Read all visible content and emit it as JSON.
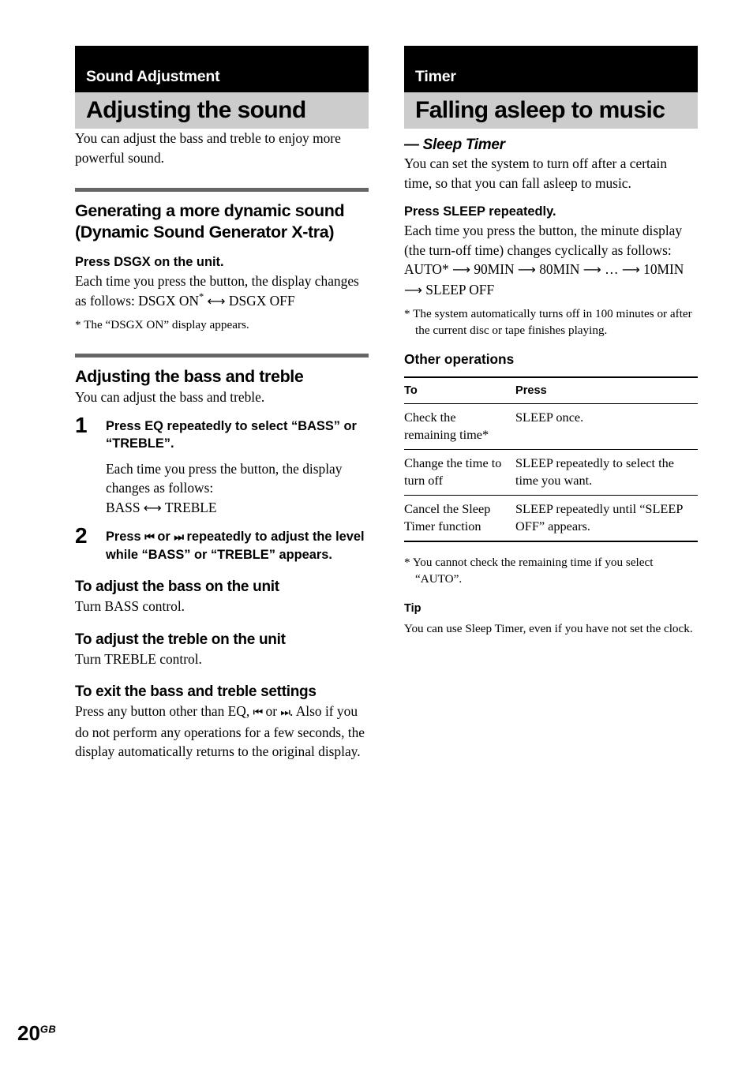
{
  "page": {
    "number": "20",
    "region_code": "GB"
  },
  "left_column": {
    "chapter": "Sound Adjustment",
    "title": "Adjusting the sound",
    "intro": "You can adjust the bass and treble to enjoy more powerful sound.",
    "section_dsgx": {
      "heading": "Generating a more dynamic sound (Dynamic Sound Generator X-tra)",
      "instruction": "Press DSGX on the unit.",
      "body_prefix": "Each time you press the button, the display changes as follows: DSGX ON",
      "star": "*",
      "arrow": "⟷",
      "body_suffix": "DSGX OFF",
      "footnote": "* The “DSGX ON” display appears."
    },
    "section_bass_treble": {
      "heading": "Adjusting the bass and treble",
      "intro": "You can adjust the bass and treble.",
      "steps": [
        {
          "number": "1",
          "title": "Press EQ repeatedly to select “BASS” or “TREBLE”.",
          "body": "Each time you press the button, the display changes as follows:",
          "sequence_left": "BASS",
          "sequence_arrow": "⟷",
          "sequence_right": "TREBLE"
        },
        {
          "number": "2",
          "title_prefix": "Press",
          "icon_prev": "⏮",
          "title_mid": "or",
          "icon_next": "⏭",
          "title_suffix": "repeatedly to adjust the level while “BASS” or “TREBLE” appears."
        }
      ]
    },
    "section_bass_unit": {
      "heading": "To adjust the bass on the unit",
      "body": "Turn BASS control."
    },
    "section_treble_unit": {
      "heading": "To adjust the treble on the unit",
      "body": "Turn TREBLE control."
    },
    "section_exit": {
      "heading": "To exit the bass and treble settings",
      "body_prefix": "Press any button other than EQ,",
      "icon_prev": "⏮",
      "body_mid": "or",
      "icon_next": "⏭",
      "body_suffix": ". Also if you do not perform any operations for a few seconds, the display automatically returns to the original display."
    }
  },
  "right_column": {
    "chapter": "Timer",
    "title": "Falling asleep to music",
    "subtitle": "— Sleep Timer",
    "intro": "You can set the system to turn off after a certain time, so that you can fall asleep to music.",
    "instruction": "Press SLEEP repeatedly.",
    "body": "Each time you press the button, the minute display (the turn-off time) changes cyclically as follows:",
    "sequence": {
      "items": [
        "AUTO*",
        "90MIN",
        "80MIN",
        "…",
        "10MIN",
        "SLEEP OFF"
      ],
      "arrow": "⟶"
    },
    "footnote": "* The system automatically turns off in 100 minutes or after the current disc or tape finishes playing.",
    "other_operations": {
      "heading": "Other operations",
      "columns": [
        "To",
        "Press"
      ],
      "rows": [
        [
          "Check the remaining time*",
          "SLEEP once."
        ],
        [
          "Change the time to turn off",
          "SLEEP repeatedly to select the time you want."
        ],
        [
          "Cancel the Sleep Timer function",
          "SLEEP repeatedly until “SLEEP OFF” appears."
        ]
      ]
    },
    "table_footnote": "* You cannot check the remaining time if you select “AUTO”.",
    "tip": {
      "heading": "Tip",
      "body": "You can use Sleep Timer, even if you have not set the clock."
    }
  }
}
